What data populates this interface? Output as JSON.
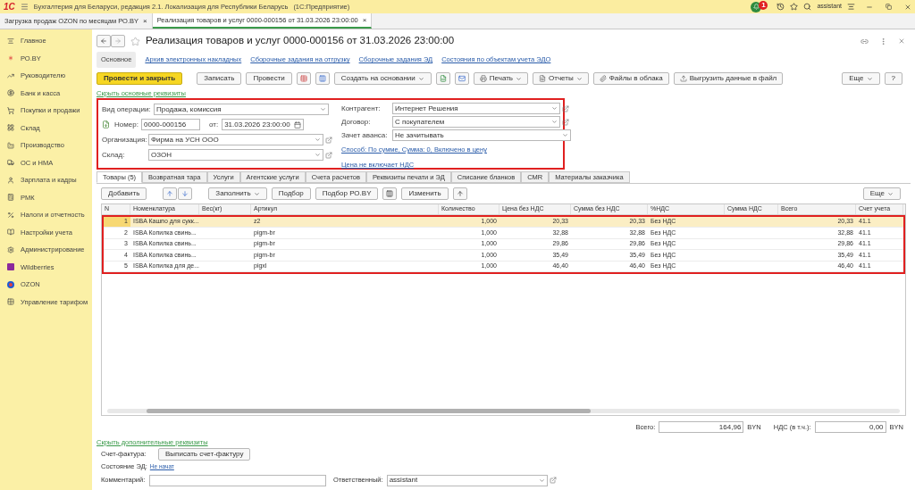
{
  "app": {
    "logo": "1С",
    "title": "Бухгалтерия для Беларуси, редакция 2.1. Локализация для Республики Беларусь",
    "platform": "(1С:Предприятие)",
    "notifications": "1",
    "user": "assistant"
  },
  "open_tabs": [
    {
      "label": "Загрузка продаж OZON по месяцам РО.BY",
      "close": "×",
      "selected": false
    },
    {
      "label": "Реализация товаров и услуг 0000-000156 от 31.03.2026 23:00:00",
      "close": "×",
      "selected": true
    }
  ],
  "sidebar": {
    "items": [
      {
        "label": "Главное"
      },
      {
        "label": "РО.BY"
      },
      {
        "label": "Руководителю"
      },
      {
        "label": "Банк и касса"
      },
      {
        "label": "Покупки и продажи"
      },
      {
        "label": "Склад"
      },
      {
        "label": "Производство"
      },
      {
        "label": "ОС и НМА"
      },
      {
        "label": "Зарплата и кадры"
      },
      {
        "label": "РМК"
      },
      {
        "label": "Налоги и отчетность"
      },
      {
        "label": "Настройки учета"
      },
      {
        "label": "Администрирование"
      },
      {
        "label": "Wildberries"
      },
      {
        "label": "OZON"
      },
      {
        "label": "Управление тарифом"
      }
    ]
  },
  "document": {
    "title": "Реализация товаров и услуг 0000-000156 от 31.03.2026 23:00:00",
    "nav": [
      {
        "label": "Основное",
        "selected": true
      },
      {
        "label": "Архив электронных накладных",
        "selected": false
      },
      {
        "label": "Сборочные задания на отгрузку",
        "selected": false
      },
      {
        "label": "Сборочные задания ЭД",
        "selected": false
      },
      {
        "label": "Состояния по объектам учета ЭДО",
        "selected": false
      }
    ],
    "toolbar": [
      {
        "kind": "primary",
        "label": "Провести и закрыть"
      },
      {
        "kind": "button",
        "label": "Записать"
      },
      {
        "kind": "button",
        "label": "Провести"
      },
      {
        "kind": "menu",
        "label": "Создать на основании"
      },
      {
        "kind": "menu",
        "label": "Печать"
      },
      {
        "kind": "menu",
        "label": "Отчеты"
      },
      {
        "kind": "button",
        "label": "Файлы в облака"
      },
      {
        "kind": "button",
        "label": "Выгрузить данные в файл"
      }
    ],
    "more": "Еще",
    "help": "?",
    "hide_main": "Скрыть основные реквизиты",
    "left_fields": [
      {
        "kind": "select",
        "label": "Вид операции:",
        "value": "Продажа, комиссия"
      },
      {
        "kind": "number",
        "label": "Номер:",
        "value": "0000-000156",
        "date_label": "от:",
        "date": "31.03.2026 23:00:00"
      },
      {
        "kind": "select_open",
        "label": "Организация:",
        "value": "Фирма на УСН ООО"
      },
      {
        "kind": "select_open",
        "label": "Склад:",
        "value": "ОЗОН"
      }
    ],
    "right_fields": [
      {
        "kind": "select_open",
        "label": "Контрагент:",
        "value": "Интернет Решения"
      },
      {
        "kind": "select_open",
        "label": "Договор:",
        "value": "С покупателем"
      },
      {
        "kind": "select",
        "label": "Зачет аванса:",
        "value": "Не зачитывать"
      }
    ],
    "links": [
      "Способ: По сумме, Сумма: 0, Включено в цену",
      "Цена не включает НДС"
    ],
    "tabs": [
      {
        "label": "Товары (5)",
        "selected": true
      },
      {
        "label": "Возвратная тара",
        "selected": false
      },
      {
        "label": "Услуги",
        "selected": false
      },
      {
        "label": "Агентские услуги",
        "selected": false
      },
      {
        "label": "Счета расчетов",
        "selected": false
      },
      {
        "label": "Реквизиты печати и ЭД",
        "selected": false
      },
      {
        "label": "Списание бланков",
        "selected": false
      },
      {
        "label": "CMR",
        "selected": false
      },
      {
        "label": "Материалы заказчика",
        "selected": false
      }
    ],
    "table_toolbar": {
      "add": "Добавить",
      "fill": "Заполнить",
      "pick": "Подбор",
      "pick_ro": "Подбор РО.BY",
      "edit": "Изменить",
      "more": "Еще"
    },
    "table": {
      "columns": [
        "N",
        "Номенклатура",
        "Вес(кг)",
        "Артикул",
        "Количество",
        "Цена без НДС",
        "Сумма без НДС",
        "%НДС",
        "Сумма НДС",
        "Всего",
        "Счет учета"
      ],
      "rows": [
        {
          "selected": true,
          "cells": [
            "1",
            "ISBA Кашпо для сукк...",
            "",
            "z2",
            "1,000",
            "20,33",
            "20,33",
            "Без НДС",
            "",
            "20,33",
            "41.1"
          ]
        },
        {
          "selected": false,
          "cells": [
            "2",
            "ISBA Копилка свинь...",
            "",
            "pigm-br",
            "1,000",
            "32,88",
            "32,88",
            "Без НДС",
            "",
            "32,88",
            "41.1"
          ]
        },
        {
          "selected": false,
          "cells": [
            "3",
            "ISBA Копилка свинь...",
            "",
            "pigm-br",
            "1,000",
            "29,86",
            "29,86",
            "Без НДС",
            "",
            "29,86",
            "41.1"
          ]
        },
        {
          "selected": false,
          "cells": [
            "4",
            "ISBA Копилка свинь...",
            "",
            "pigm-br",
            "1,000",
            "35,49",
            "35,49",
            "Без НДС",
            "",
            "35,49",
            "41.1"
          ]
        },
        {
          "selected": false,
          "cells": [
            "5",
            "ISBA Копилка для де...",
            "",
            "pigxl",
            "1,000",
            "46,40",
            "46,40",
            "Без НДС",
            "",
            "46,40",
            "41.1"
          ]
        }
      ]
    },
    "totals": {
      "total_label": "Всего:",
      "total": "164,96",
      "currency": "BYN",
      "vat_label": "НДС (в т.ч.):",
      "vat": "0,00",
      "vat_currency": "BYN"
    },
    "hide_extra": "Скрыть дополнительные реквизиты",
    "invoice_label": "Счет-фактура:",
    "invoice_button": "Выписать счет-фактуру",
    "ed_label": "Состояние ЭД:",
    "ed_value": "Не начат",
    "comment_label": "Комментарий:",
    "responsible_label": "Ответственный:",
    "responsible": "assistant"
  }
}
